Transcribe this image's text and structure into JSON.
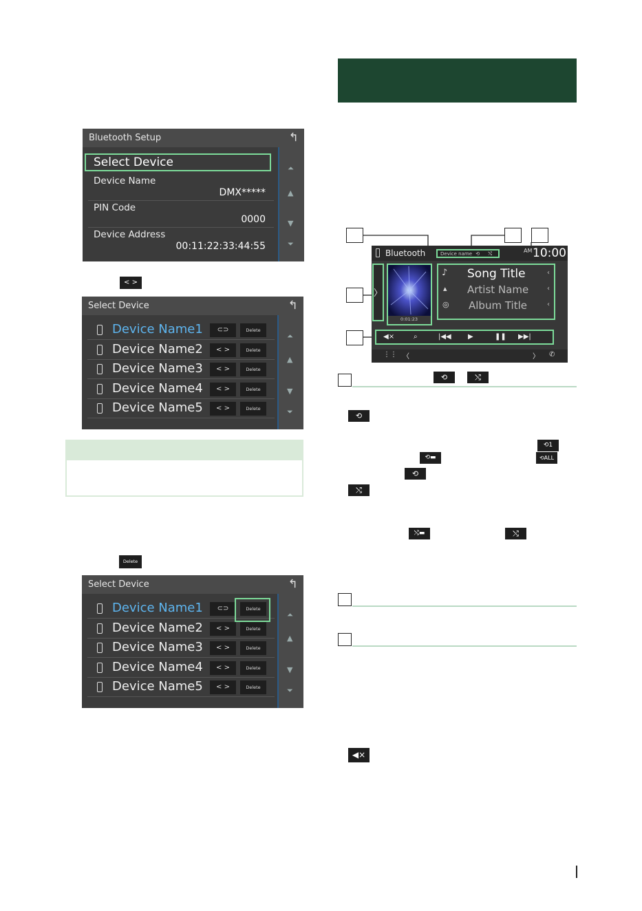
{
  "bt_setup": {
    "title": "Bluetooth Setup",
    "select_device": "Select Device",
    "device_name_label": "Device Name",
    "device_name_value": "DMX*****",
    "pin_label": "PIN Code",
    "pin_value": "0000",
    "address_label": "Device Address",
    "address_value": "00:11:22:33:44:55"
  },
  "inline_connect_icon": "< >",
  "select_device_1": {
    "title": "Select Device",
    "devices": [
      {
        "name": "Device Name1",
        "connect": "⊂⊃",
        "delete": "Delete"
      },
      {
        "name": "Device Name2",
        "connect": "< >",
        "delete": "Delete"
      },
      {
        "name": "Device Name3",
        "connect": "< >",
        "delete": "Delete"
      },
      {
        "name": "Device Name4",
        "connect": "< >",
        "delete": "Delete"
      },
      {
        "name": "Device Name5",
        "connect": "< >",
        "delete": "Delete"
      }
    ]
  },
  "inline_delete": "Delete",
  "select_device_2": {
    "title": "Select Device",
    "devices": [
      {
        "name": "Device Name1",
        "connect": "⊂⊃",
        "delete": "Delete"
      },
      {
        "name": "Device Name2",
        "connect": "< >",
        "delete": "Delete"
      },
      {
        "name": "Device Name3",
        "connect": "< >",
        "delete": "Delete"
      },
      {
        "name": "Device Name4",
        "connect": "< >",
        "delete": "Delete"
      },
      {
        "name": "Device Name5",
        "connect": "< >",
        "delete": "Delete"
      }
    ]
  },
  "player": {
    "source": "Bluetooth",
    "device_chip": "Device name",
    "am": "AM",
    "clock": "10:00",
    "song_title": "Song Title",
    "artist": "Artist Name",
    "album": "Album Title",
    "time": "0:01:23"
  },
  "colors": {
    "banner": "#1d4630",
    "note_header": "#d9ead9",
    "highlight": "#7ddc9a",
    "screen_bg": "#3b3b3b",
    "selected_device": "#5eb5ef"
  }
}
